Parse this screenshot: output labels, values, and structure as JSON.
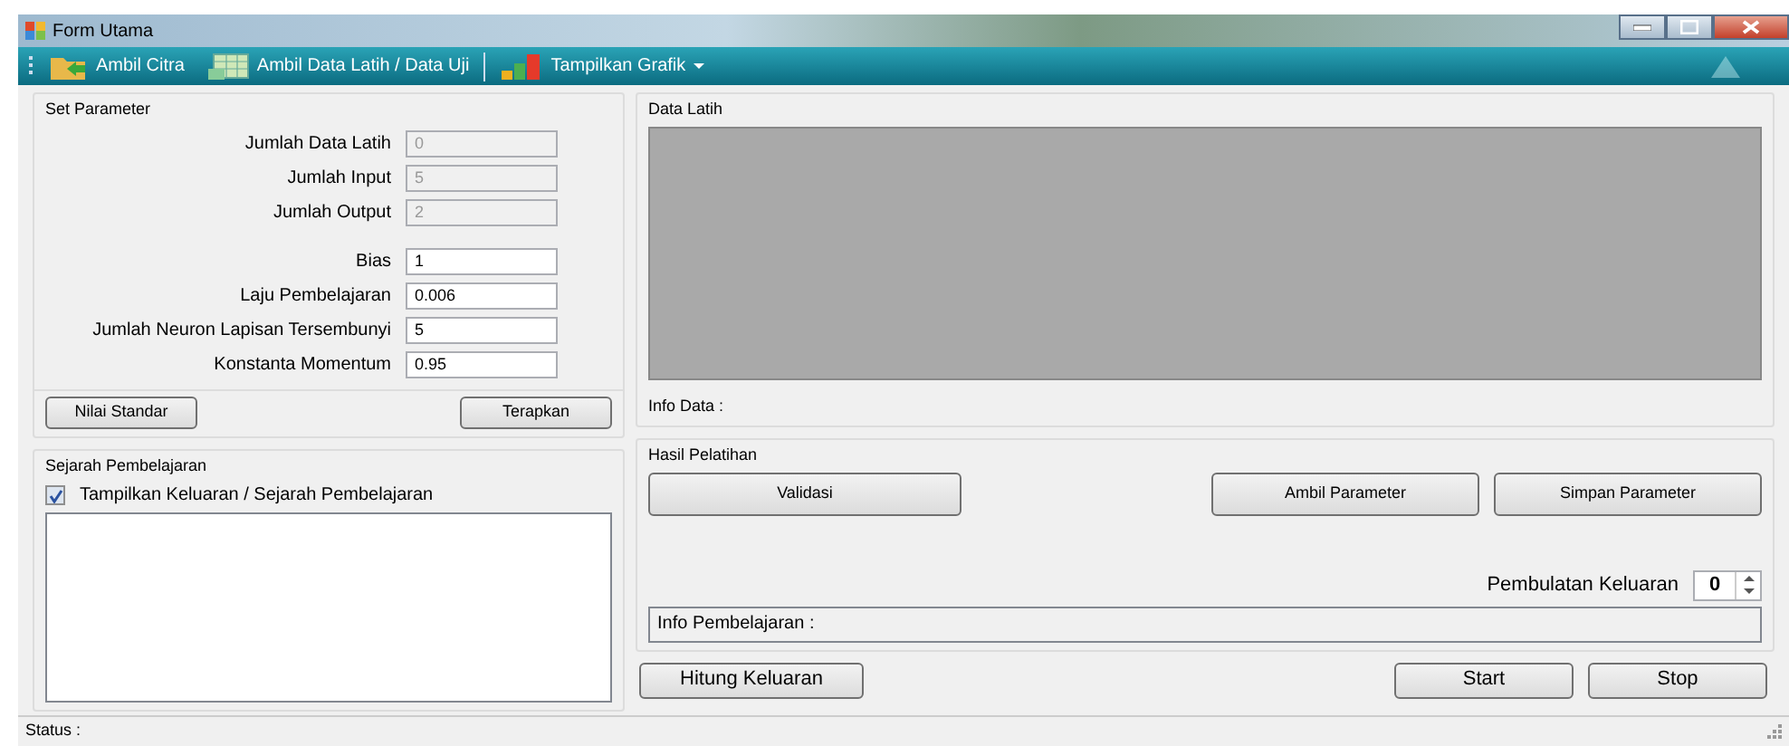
{
  "window": {
    "title": "Form Utama"
  },
  "toolbar": [
    {
      "label": "Ambil Citra",
      "kind": "folder"
    },
    {
      "label": "Ambil Data Latih / Data Uji",
      "kind": "sheet"
    },
    {
      "label": "Tampilkan Grafik",
      "kind": "chart",
      "dropdown": true
    }
  ],
  "set_parameter": {
    "title": "Set Parameter",
    "fields": [
      {
        "label": "Jumlah Data Latih",
        "value": "0",
        "disabled": true
      },
      {
        "label": "Jumlah Input",
        "value": "5",
        "disabled": true
      },
      {
        "label": "Jumlah Output",
        "value": "2",
        "disabled": true
      },
      {
        "label": "Bias",
        "value": "1",
        "disabled": false
      },
      {
        "label": "Laju Pembelajaran",
        "value": "0.006",
        "disabled": false
      },
      {
        "label": "Jumlah Neuron Lapisan Tersembunyi",
        "value": "5",
        "disabled": false
      },
      {
        "label": "Konstanta Momentum",
        "value": "0.95",
        "disabled": false
      }
    ],
    "buttons": [
      "Nilai Standar",
      "Terapkan"
    ]
  },
  "data_latih": {
    "title": "Data Latih",
    "info": "Info Data :"
  },
  "sejarah": {
    "title": "Sejarah Pembelajaran",
    "checkbox": {
      "label": "Tampilkan Keluaran / Sejarah Pembelajaran",
      "checked": true
    }
  },
  "hasil": {
    "title": "Hasil Pelatihan",
    "buttons": [
      "Validasi",
      "Ambil Parameter",
      "Simpan Parameter"
    ],
    "rounding": {
      "label": "Pembulatan Keluaran",
      "value": "0"
    },
    "info": "Info Pembelajaran :"
  },
  "bottom_buttons": [
    "Hitung Keluaran",
    "Start",
    "Stop"
  ],
  "status": "Status :"
}
